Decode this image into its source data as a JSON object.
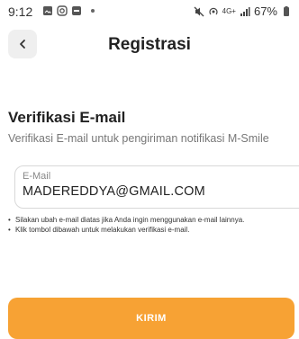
{
  "status_bar": {
    "time": "9:12",
    "battery": "67%",
    "network": "4G+"
  },
  "header": {
    "title": "Registrasi",
    "back_icon": "chevron-left-icon"
  },
  "section": {
    "title": "Verifikasi E-mail",
    "subtitle": "Verifikasi E-mail untuk pengiriman notifikasi M-Smile"
  },
  "email_field": {
    "label": "E-Mail",
    "value": "MADEREDDYA@GMAIL.COM"
  },
  "notes": [
    "Silakan ubah e-mail diatas jika Anda ingin menggunakan e-mail lainnya.",
    "Klik tombol dibawah untuk melakukan verifikasi e-mail."
  ],
  "submit_button": {
    "label": "KIRIM"
  },
  "colors": {
    "accent": "#f7a234",
    "back_button_bg": "#efefef"
  }
}
